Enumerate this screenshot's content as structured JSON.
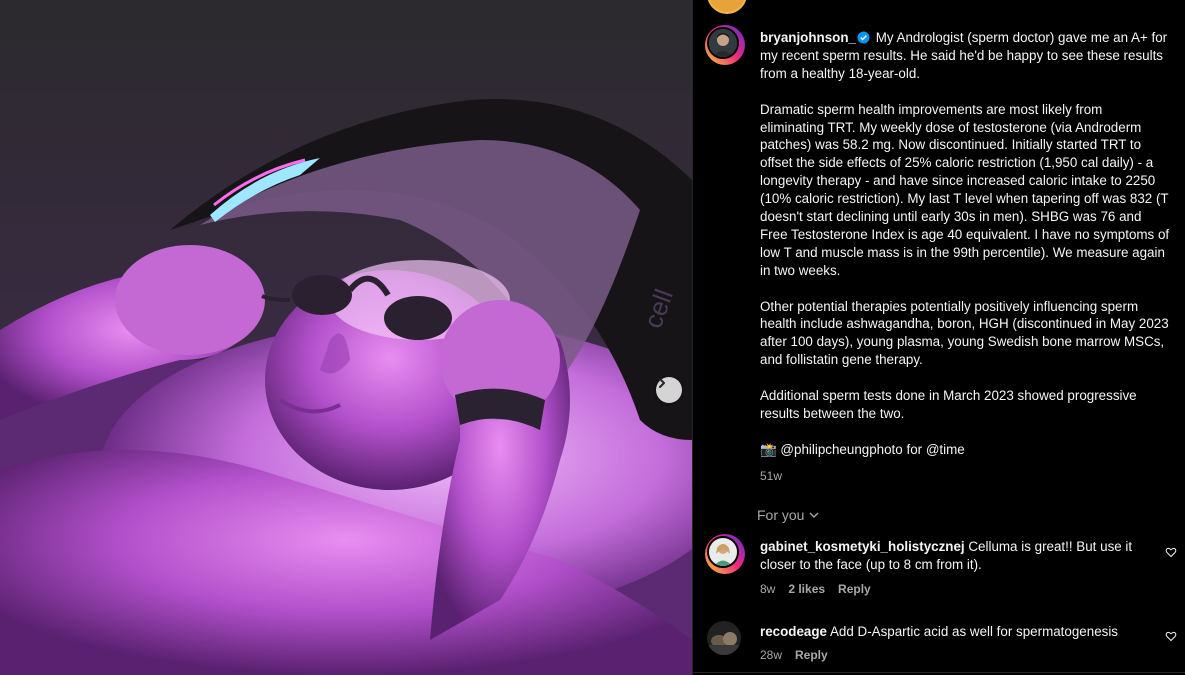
{
  "post": {
    "username": "bryanjohnson_",
    "caption_intro": "My Andrologist (sperm doctor) gave me an A+ for my recent sperm results. He said he'd be happy to see these results from a healthy 18-year-old.",
    "paragraphs": [
      "Dramatic sperm health improvements are most likely from eliminating TRT. My weekly dose of testosterone (via Androderm patches) was 58.2 mg. Now discontinued. Initially started TRT to offset the side effects of 25% caloric restriction (1,950 cal daily) - a longevity therapy - and have since increased caloric intake to 2250 (10% caloric restriction). My last T level when tapering off was 832 (T doesn't start declining until early 30s in men). SHBG was 76 and Free Testosterone Index is age 40 equivalent. I have no symptoms of low T and muscle mass is in the 99th percentile). We measure again in two weeks.",
      "Other potential therapies potentially positively influencing sperm health include ashwagandha, boron, HGH (discontinued in May 2023 after 100 days), young plasma, young Swedish bone marrow MSCs, and follistatin gene therapy.",
      "Additional sperm tests done in March 2023 showed progressive results between the two."
    ],
    "credit_emoji": "📸",
    "credit_handle": "@philipcheungphoto",
    "credit_for": "for",
    "credit_tag": "@time",
    "time_ago": "51w"
  },
  "for_you_label": "For you",
  "comments": [
    {
      "username": "gabinet_kosmetyki_holistycznej",
      "text": "Celluma is great!! But use it closer to the face (up to 8 cm from it).",
      "time_ago": "8w",
      "likes": "2 likes",
      "reply_label": "Reply"
    },
    {
      "username": "recodeage",
      "text": "Add D-Aspartic acid as well for spermatogenesis",
      "time_ago": "28w",
      "reply_label": "Reply"
    }
  ],
  "media": {
    "device_text": "cell",
    "next_icon": "chevron-right-icon"
  },
  "colors": {
    "background": "#000000",
    "text": "#f5f5f5",
    "secondary_text": "#a8a8a8",
    "verified_blue": "#0095f6"
  }
}
